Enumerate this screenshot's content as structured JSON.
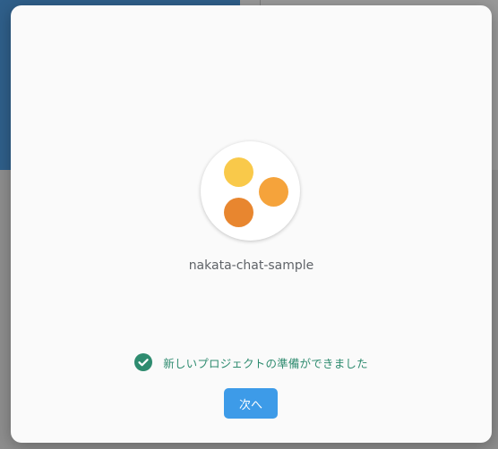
{
  "project": {
    "name": "nakata-chat-sample",
    "logo_colors": [
      "#f9c94a",
      "#f5a33b",
      "#e8862f"
    ]
  },
  "status": {
    "icon": "check-circle-icon",
    "text": "新しいプロジェクトの準備ができました",
    "color": "#2e8b6f"
  },
  "actions": {
    "next_label": "次へ",
    "next_color": "#3d9be8"
  }
}
